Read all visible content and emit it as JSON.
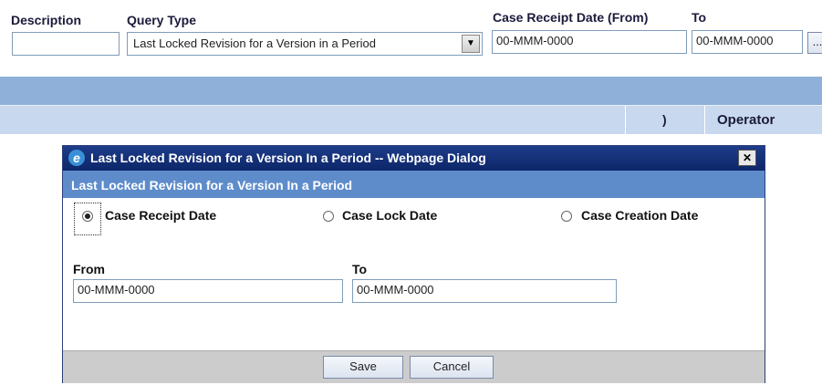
{
  "header": {
    "description_label": "Description",
    "description_value": "",
    "query_type_label": "Query Type",
    "query_type_value": "Last Locked Revision for a Version in a Period",
    "from_label": "Case Receipt Date (From)",
    "from_value": "00-MMM-0000",
    "to_label": "To",
    "to_value": "00-MMM-0000",
    "ellipsis": "..."
  },
  "grid": {
    "paren_col": ")",
    "operator_col": "Operator"
  },
  "dialog": {
    "title": "Last Locked Revision for a Version In a Period -- Webpage Dialog",
    "close_symbol": "✕",
    "subtitle": "Last Locked Revision for a Version In a Period",
    "radios": [
      {
        "label": "Case Receipt Date",
        "selected": true
      },
      {
        "label": "Case Lock Date",
        "selected": false
      },
      {
        "label": "Case Creation Date",
        "selected": false
      }
    ],
    "from_label": "From",
    "from_value": "00-MMM-0000",
    "to_label": "To",
    "to_value": "00-MMM-0000",
    "save_label": "Save",
    "cancel_label": "Cancel"
  }
}
